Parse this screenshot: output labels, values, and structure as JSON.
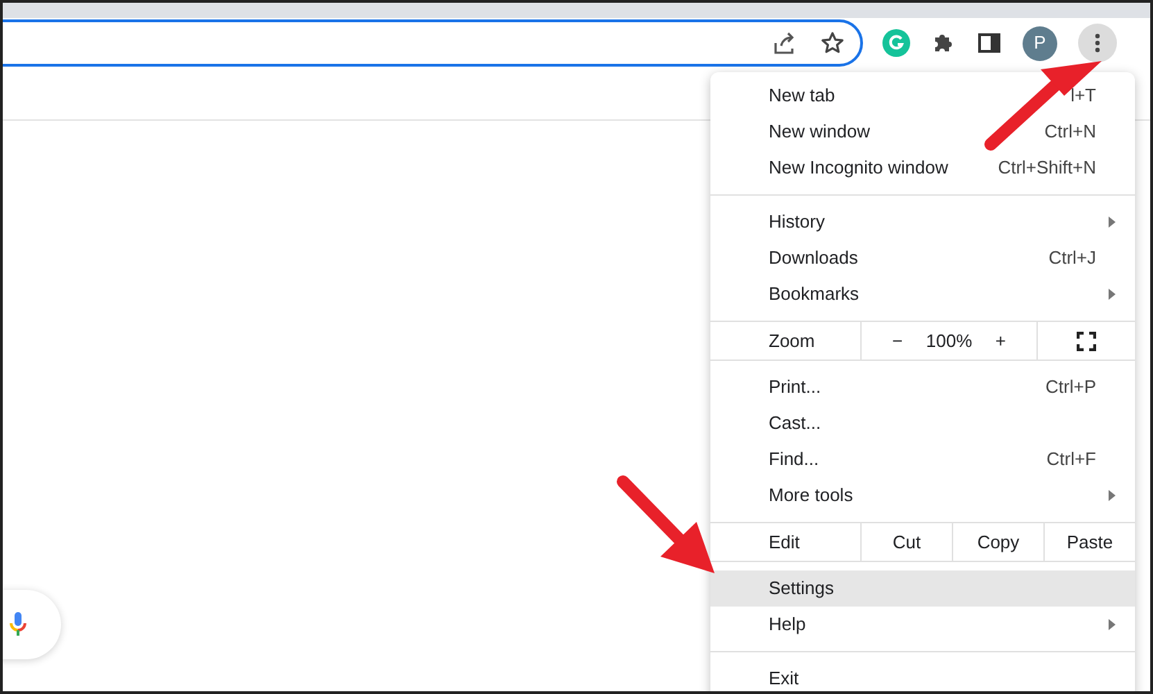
{
  "toolbar": {
    "avatar": "P"
  },
  "menu": {
    "sections": [
      {
        "kind": "items",
        "items": [
          {
            "label": "New tab",
            "shortcut": "l+T",
            "submenu": false,
            "selected": false
          },
          {
            "label": "New window",
            "shortcut": "Ctrl+N",
            "submenu": false,
            "selected": false
          },
          {
            "label": "New Incognito window",
            "shortcut": "Ctrl+Shift+N",
            "submenu": false,
            "selected": false
          }
        ]
      },
      {
        "kind": "items",
        "items": [
          {
            "label": "History",
            "submenu": true,
            "selected": false
          },
          {
            "label": "Downloads",
            "shortcut": "Ctrl+J",
            "submenu": false,
            "selected": false
          },
          {
            "label": "Bookmarks",
            "submenu": true,
            "selected": false
          }
        ]
      },
      {
        "kind": "zoom",
        "label": "Zoom",
        "minus": "−",
        "value": "100%",
        "plus": "+"
      },
      {
        "kind": "items",
        "items": [
          {
            "label": "Print...",
            "shortcut": "Ctrl+P",
            "submenu": false,
            "selected": false
          },
          {
            "label": "Cast...",
            "submenu": false,
            "selected": false
          },
          {
            "label": "Find...",
            "shortcut": "Ctrl+F",
            "submenu": false,
            "selected": false
          },
          {
            "label": "More tools",
            "submenu": true,
            "selected": false
          }
        ]
      },
      {
        "kind": "edit",
        "label": "Edit",
        "buttons": [
          "Cut",
          "Copy",
          "Paste"
        ]
      },
      {
        "kind": "items",
        "items": [
          {
            "label": "Settings",
            "submenu": false,
            "selected": true
          },
          {
            "label": "Help",
            "submenu": true,
            "selected": false
          }
        ]
      },
      {
        "kind": "items",
        "items": [
          {
            "label": "Exit",
            "submenu": false,
            "selected": false
          }
        ]
      }
    ]
  }
}
